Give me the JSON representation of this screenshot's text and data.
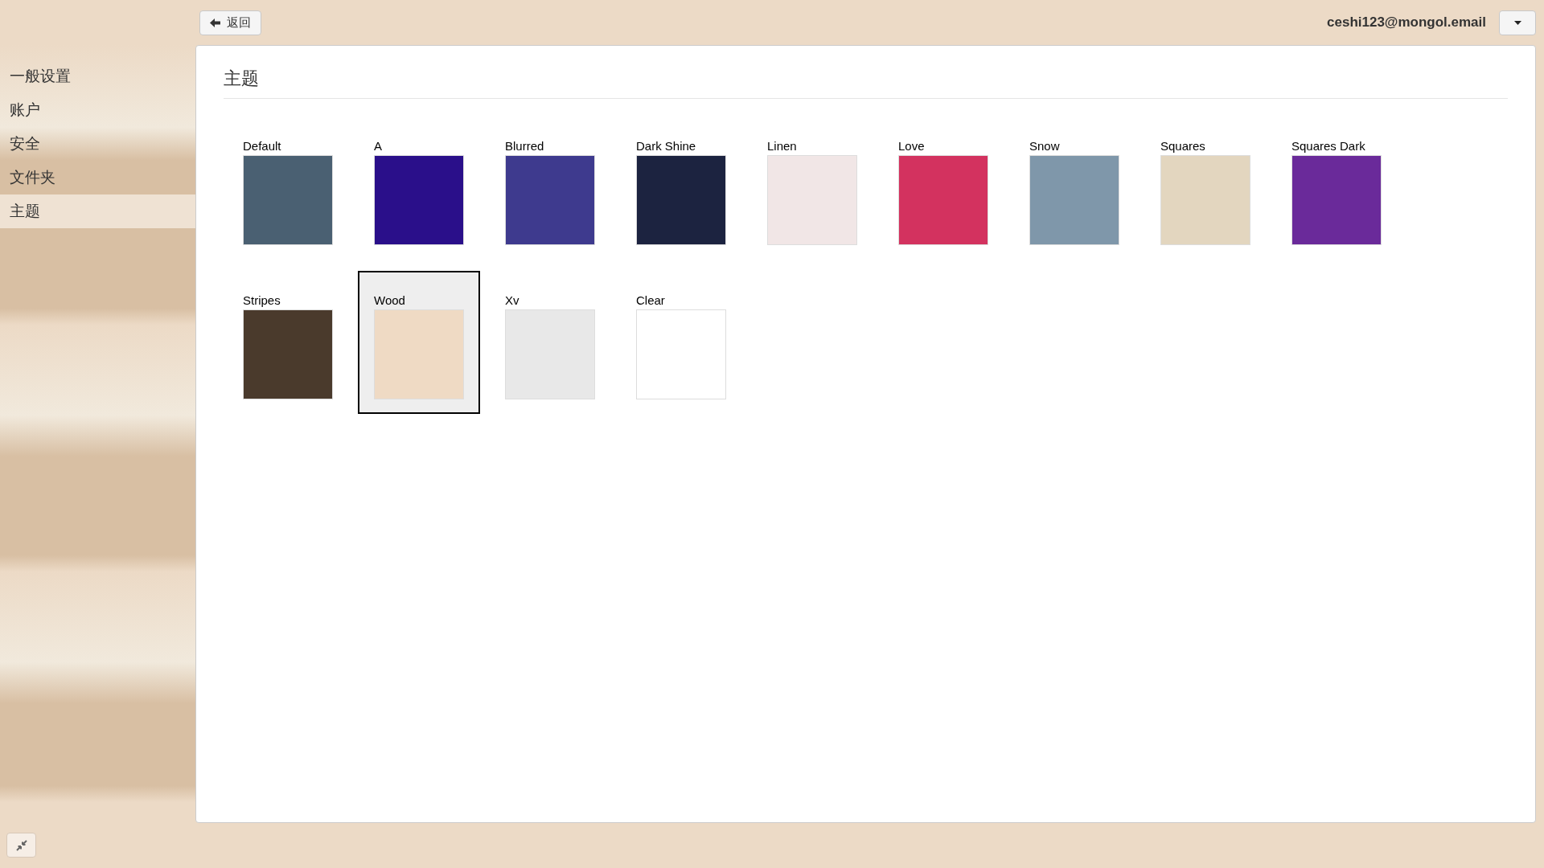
{
  "top_bar": {
    "back_button": "返回",
    "account": "ceshi123@mongol.email"
  },
  "sidebar": {
    "items": [
      {
        "label": "一般设置",
        "selected": false
      },
      {
        "label": "账户",
        "selected": false
      },
      {
        "label": "安全",
        "selected": false
      },
      {
        "label": "文件夹",
        "selected": false
      },
      {
        "label": "主题",
        "selected": true
      }
    ]
  },
  "panel": {
    "title": "主题",
    "themes": [
      {
        "label": "Default",
        "color": "#4a6072",
        "selected": false
      },
      {
        "label": "A",
        "color": "#2a0f8a",
        "selected": false
      },
      {
        "label": "Blurred",
        "color": "#3e3a8e",
        "selected": false
      },
      {
        "label": "Dark Shine",
        "color": "#1c2340",
        "selected": false
      },
      {
        "label": "Linen",
        "color": "#f1e6e6",
        "selected": false
      },
      {
        "label": "Love",
        "color": "#d3325f",
        "selected": false
      },
      {
        "label": "Snow",
        "color": "#7f97aa",
        "selected": false
      },
      {
        "label": "Squares",
        "color": "#e3d6bf",
        "selected": false
      },
      {
        "label": "Squares Dark",
        "color": "#6a2a9a",
        "selected": false
      },
      {
        "label": "Stripes",
        "color": "#4a3a2c",
        "selected": false
      },
      {
        "label": "Wood",
        "color": "#efdac4",
        "selected": true
      },
      {
        "label": "Xv",
        "color": "#e8e8e8",
        "selected": false
      },
      {
        "label": "Clear",
        "color": "#ffffff",
        "selected": false
      }
    ]
  }
}
